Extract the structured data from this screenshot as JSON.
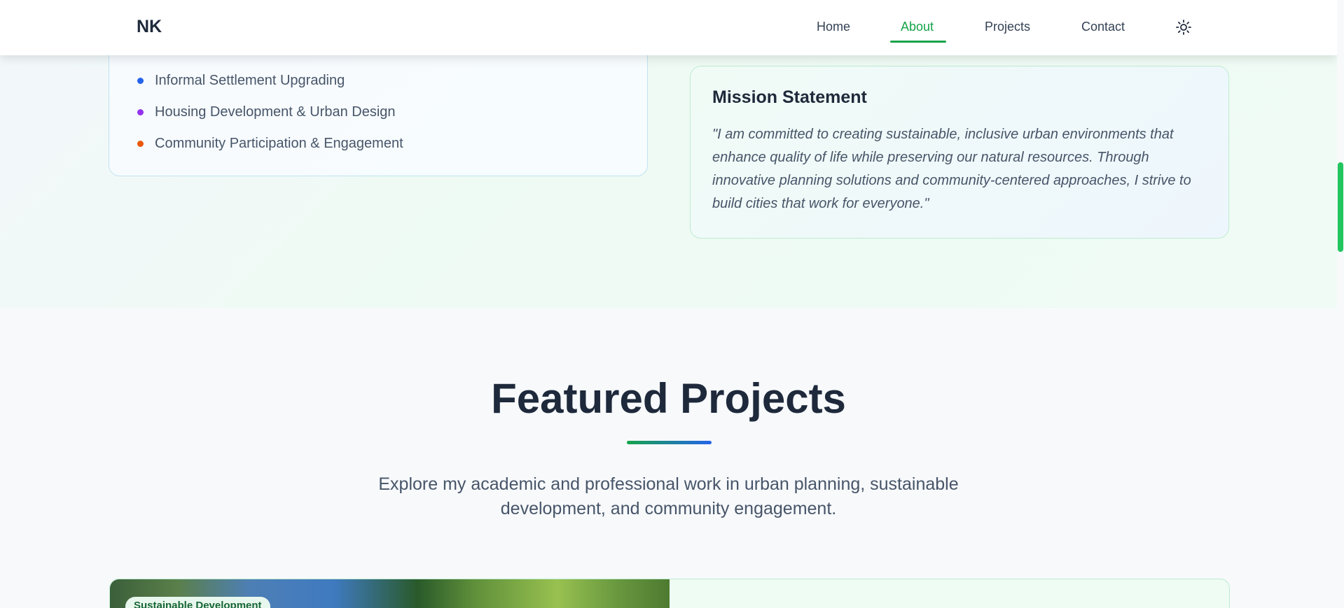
{
  "nav": {
    "logo": "NK",
    "links": [
      {
        "label": "Home"
      },
      {
        "label": "About"
      },
      {
        "label": "Projects"
      },
      {
        "label": "Contact"
      }
    ],
    "active": "About",
    "theme_icon": "sun-icon"
  },
  "about": {
    "focus_areas": [
      {
        "label": "Informal Settlement Upgrading",
        "color": "#2563eb"
      },
      {
        "label": "Housing Development & Urban Design",
        "color": "#9333ea"
      },
      {
        "label": "Community Participation & Engagement",
        "color": "#ea580c"
      }
    ],
    "mission": {
      "title": "Mission Statement",
      "text": "\"I am committed to creating sustainable, inclusive urban environments that enhance quality of life while preserving our natural resources. Through innovative planning solutions and community-centered approaches, I strive to build cities that work for everyone.\""
    }
  },
  "projects": {
    "title": "Featured Projects",
    "subtitle": "Explore my academic and professional work in urban planning, sustainable development, and community engagement.",
    "cards": [
      {
        "badge": "Sustainable Development"
      }
    ]
  },
  "colors": {
    "accent": "#16a34a",
    "secondary": "#2563eb"
  }
}
